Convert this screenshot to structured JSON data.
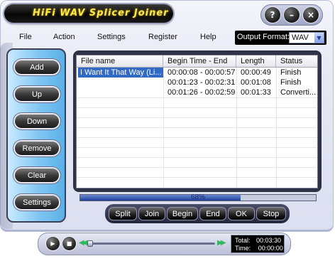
{
  "window": {
    "title": "HiFi WAV Splicer Joiner",
    "controls": [
      {
        "name": "help-button",
        "icon": "question-icon",
        "glyph": "?"
      },
      {
        "name": "minimize-button",
        "icon": "minimize-icon",
        "glyph": "–"
      },
      {
        "name": "close-button",
        "icon": "close-icon",
        "glyph": "×"
      }
    ]
  },
  "menu": {
    "items": [
      "File",
      "Action",
      "Settings",
      "Register",
      "Help"
    ]
  },
  "output_format": {
    "label": "Output Format:",
    "value": "WAV",
    "arrow_icon": "chevron-down-icon"
  },
  "left_buttons": [
    "Add",
    "Up",
    "Down",
    "Remove",
    "Clear",
    "Settings"
  ],
  "list": {
    "columns": [
      "File name",
      "Begin Time - End",
      "Length",
      "Status"
    ],
    "rows": [
      {
        "file": "I Want It That Way (Li...",
        "range": "00:00:08 - 00:00:57",
        "length": "00:00:49",
        "status": "Finish",
        "selected": true
      },
      {
        "file": "",
        "range": "00:01:23 - 00:02:31",
        "length": "00:01:08",
        "status": "Finish",
        "selected": false
      },
      {
        "file": "",
        "range": "00:01:26 - 00:02:59",
        "length": "00:01:33",
        "status": "Converti...",
        "selected": false
      }
    ]
  },
  "progress": {
    "value": 0.68,
    "label": "68%"
  },
  "actions": [
    "Split",
    "Join",
    "Begin",
    "End",
    "OK",
    "Stop"
  ],
  "player": {
    "play_icon": "play-icon",
    "stop_icon": "stop-icon",
    "rewind_icon": "rewind-icon",
    "forward_icon": "fast-forward-icon",
    "seek_position": 0.0,
    "total_label": "Total:",
    "total_value": "00:03:30",
    "time_label": "Time:",
    "time_value": "00:00:00"
  },
  "colors": {
    "title_text": "#ffe84a",
    "panel_blue": "#7fc6f2",
    "selection": "#316ac5",
    "progress_fill": "#1f3f99",
    "seek_arrows": "#2fb85a"
  }
}
